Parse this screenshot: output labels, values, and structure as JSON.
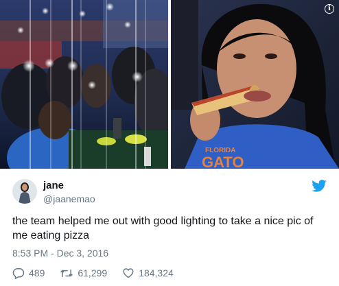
{
  "media": {
    "info_icon": "info-icon",
    "photos": [
      {
        "name": "team-holding-phone-lights-photo"
      },
      {
        "name": "girl-eating-pizza-photo"
      }
    ]
  },
  "user": {
    "display_name": "jane",
    "handle": "@jaanemao",
    "avatar_icon": "avatar"
  },
  "brand": {
    "logo_icon": "twitter-bird-icon",
    "color": "#1da1f2"
  },
  "tweet": {
    "text": "the team helped me out with good lighting to take a nice pic of me eating pizza",
    "timestamp": "8:53 PM - Dec 3, 2016"
  },
  "actions": [
    {
      "icon": "reply-icon",
      "count": "489"
    },
    {
      "icon": "retweet-icon",
      "count": "61,299"
    },
    {
      "icon": "like-icon",
      "count": "184,324"
    }
  ],
  "colors": {
    "text_primary": "#14171a",
    "text_secondary": "#657786",
    "icon_gray": "#657786"
  }
}
